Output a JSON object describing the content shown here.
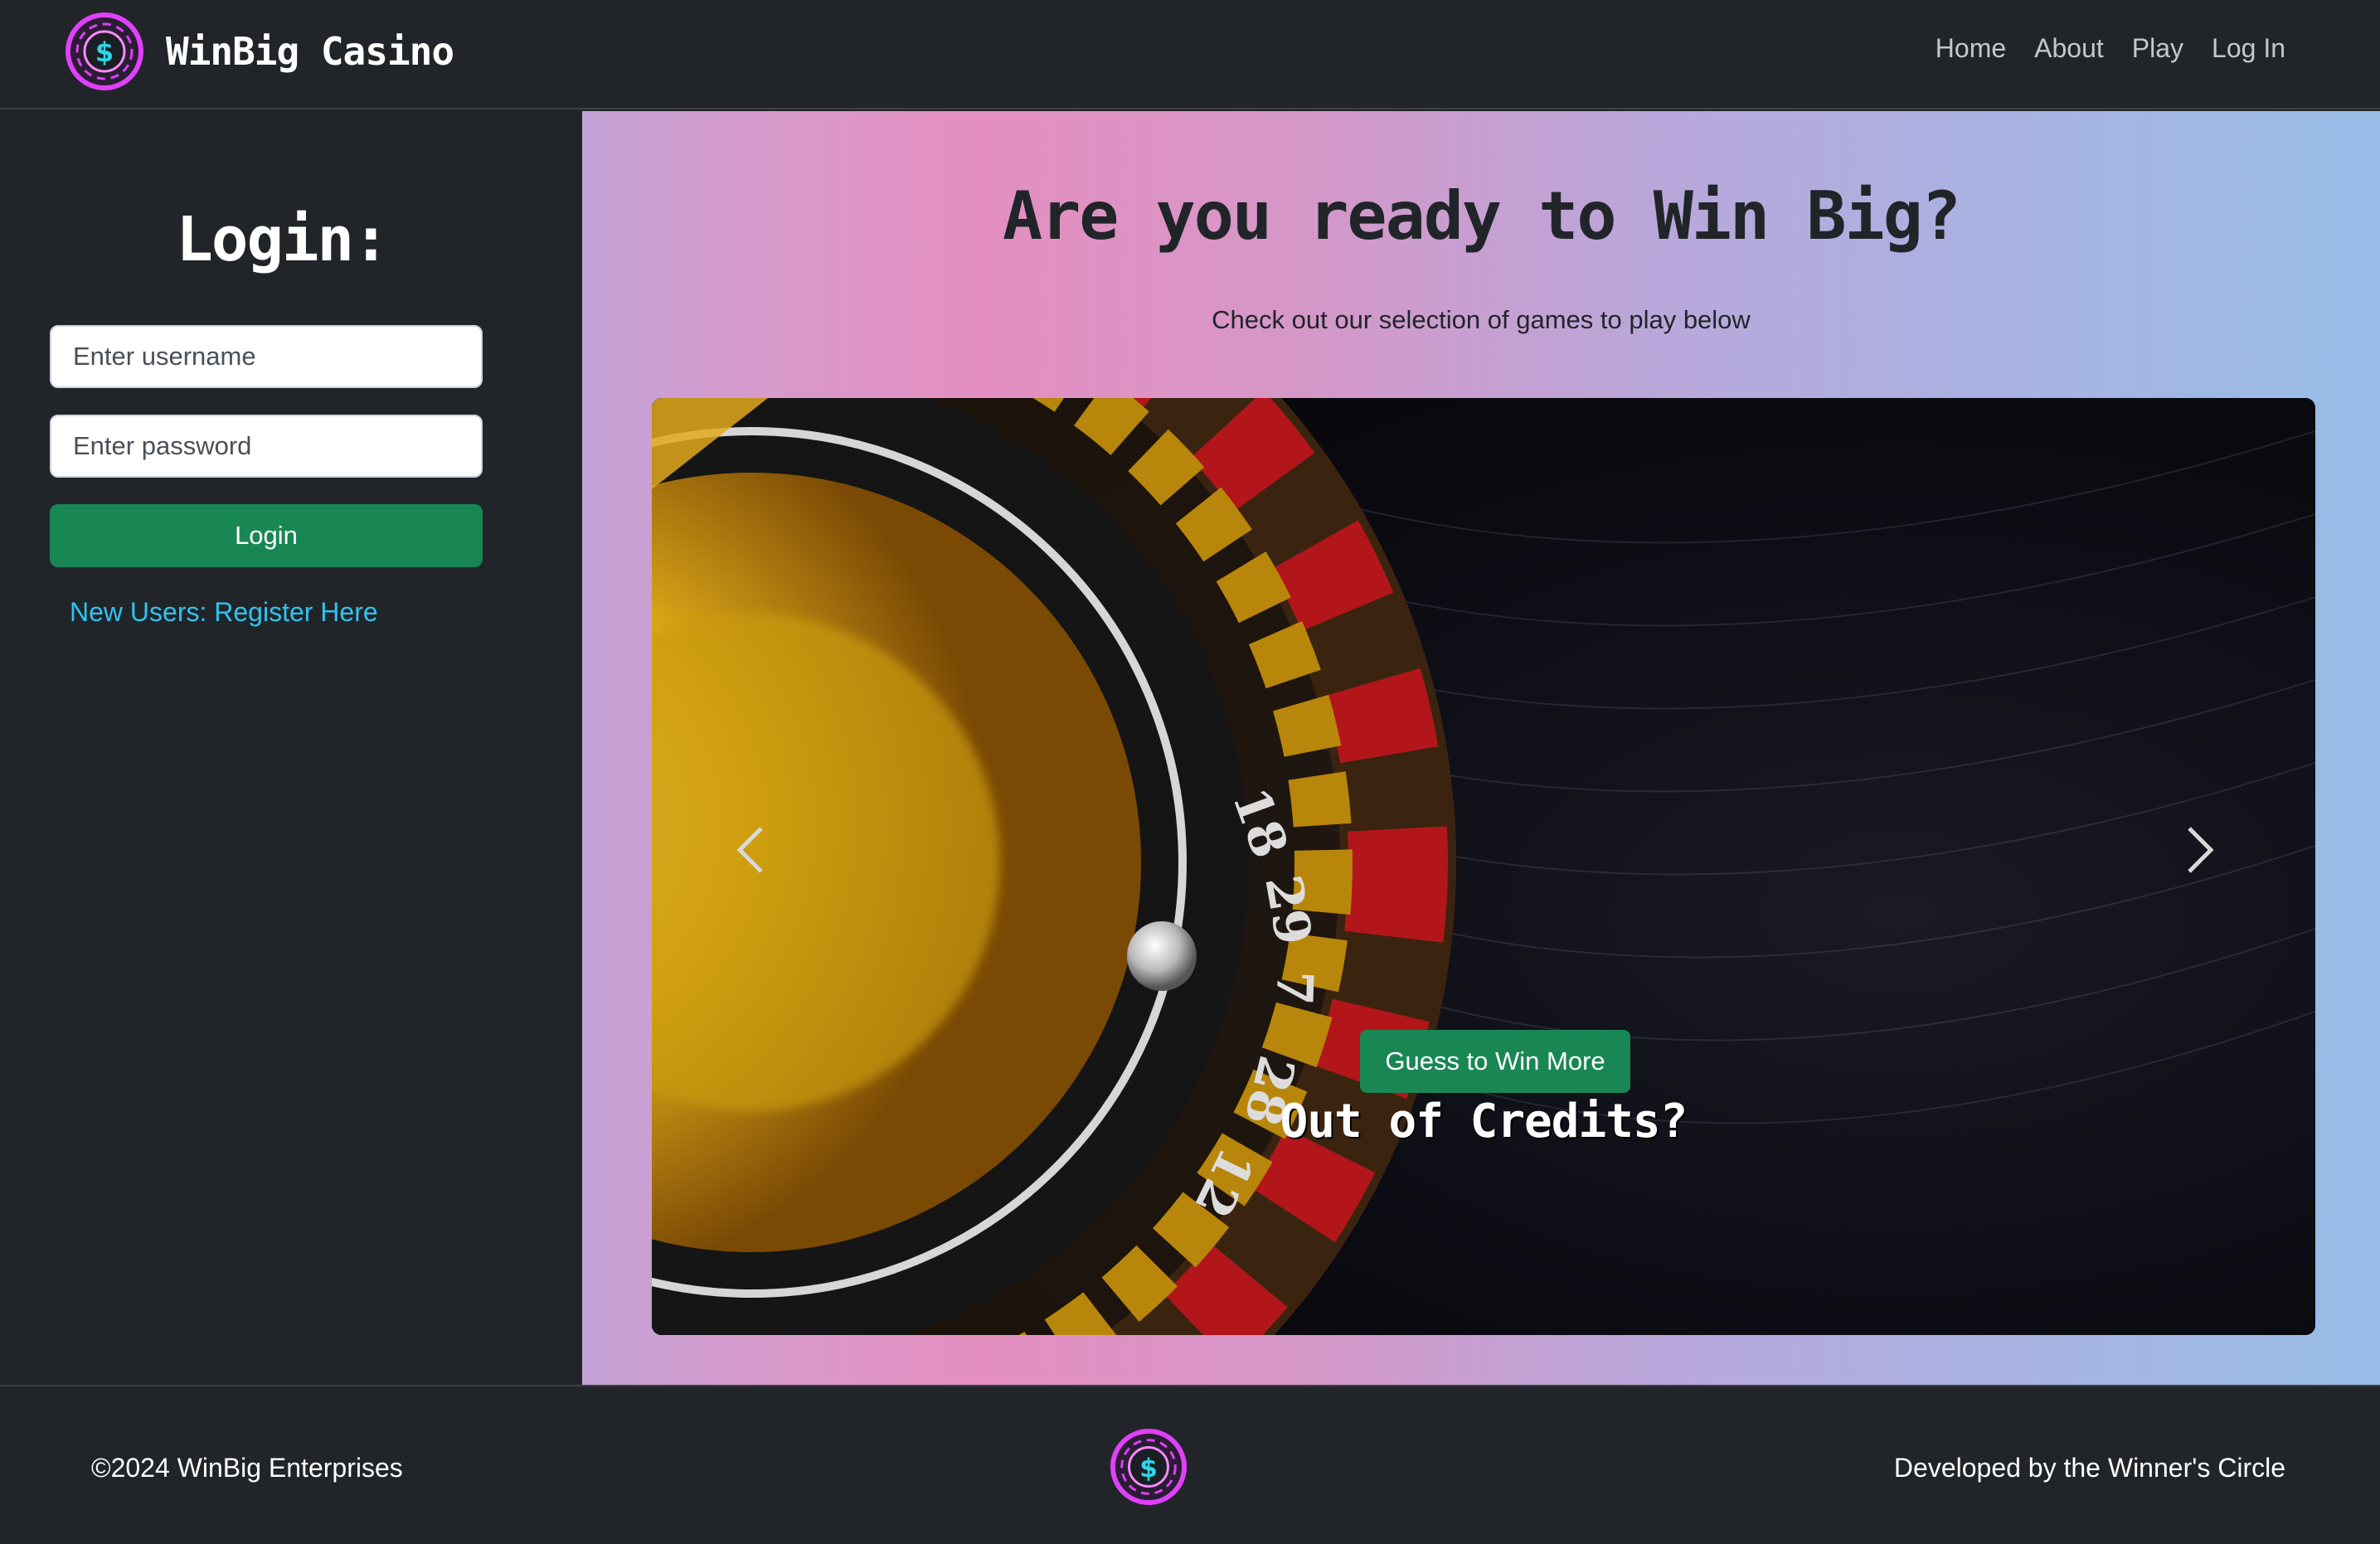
{
  "brand": {
    "name": "WinBig Casino",
    "logo_icon": "dollar-chip-icon",
    "accent": "#e040fb",
    "dollar_color": "#2fd4e8"
  },
  "nav": {
    "items": [
      {
        "label": "Home"
      },
      {
        "label": "About"
      },
      {
        "label": "Play"
      },
      {
        "label": "Log In"
      }
    ]
  },
  "sidebar": {
    "title": "Login:",
    "username_placeholder": "Enter username",
    "password_placeholder": "Enter password",
    "login_button": "Login",
    "register_link": "New Users: Register Here"
  },
  "main": {
    "title": "Are you ready to Win Big?",
    "subtitle": "Check out our selection of games to play below"
  },
  "carousel": {
    "slide_image": "roulette-wheel",
    "prev_icon": "chevron-left-icon",
    "next_icon": "chevron-right-icon",
    "wheel_numbers": [
      "18",
      "29",
      "7",
      "28",
      "12"
    ],
    "caption_title": "Out of Credits?",
    "caption_button": "Guess to Win More"
  },
  "footer": {
    "left_text": "©2024 WinBig Enterprises",
    "right_text": "Developed by the Winner's Circle",
    "logo_icon": "dollar-chip-icon"
  },
  "colors": {
    "dark": "#212529",
    "success": "#198754",
    "link": "#2fc4f0"
  }
}
